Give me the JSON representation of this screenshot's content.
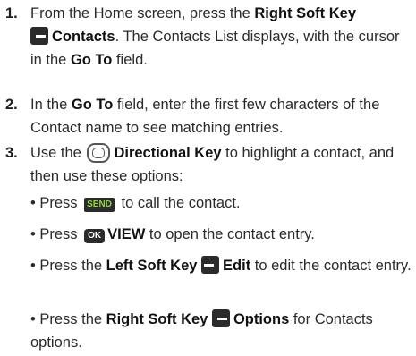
{
  "steps": [
    {
      "number": "1.",
      "t1": "From the Home screen, press the ",
      "b1": "Right Soft Key",
      "b2": "Contacts",
      "t2": ". The Contacts List displays, with the cursor in the ",
      "b3": "Go To",
      "t3": " field."
    },
    {
      "number": "2.",
      "t1": "In the ",
      "b1": "Go To",
      "t2": " field, enter the first few characters of the Contact name to see matching entries."
    },
    {
      "number": "3.",
      "t1": "Use the ",
      "b1": "Directional Key",
      "t2": " to highlight a contact, and then use these options:"
    }
  ],
  "bullets": [
    {
      "bullet": "•",
      "t1": "Press ",
      "key": "SEND",
      "t2": " to call the contact."
    },
    {
      "bullet": "•",
      "t1": "Press ",
      "key": "OK",
      "b1": "VIEW",
      "t2": " to open the contact entry."
    },
    {
      "bullet": "•",
      "t1": "Press the ",
      "b1": "Left Soft Key",
      "b2": "Edit",
      "t2": " to edit the contact entry."
    },
    {
      "bullet": "•",
      "t1": "Press the ",
      "b1": "Right Soft Key",
      "b2": "Options",
      "t2": " for Contacts options."
    }
  ],
  "colors": {
    "send_text": "#8fd43a",
    "key_bg": "#2b2b2b"
  },
  "icons": [
    "right-soft-key-icon",
    "directional-key-icon",
    "send-key-icon",
    "ok-key-icon",
    "left-soft-key-icon"
  ]
}
